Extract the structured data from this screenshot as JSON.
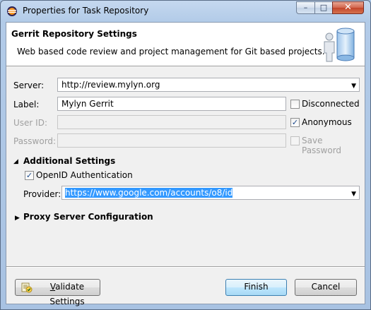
{
  "window": {
    "title": "Properties for Task Repository",
    "min_glyph": "–",
    "max_glyph": "□",
    "close_glyph": "✕"
  },
  "banner": {
    "title": "Gerrit Repository Settings",
    "description": "Web based code review and project management for Git based projects."
  },
  "form": {
    "server_label": "Server:",
    "server_value": "http://review.mylyn.org",
    "label_label": "Label:",
    "label_value": "Mylyn Gerrit",
    "userid_label": "User ID:",
    "userid_value": "",
    "password_label": "Password:",
    "password_value": "",
    "disconnected_label": "Disconnected",
    "disconnected_checked": false,
    "anonymous_label": "Anonymous",
    "anonymous_checked": true,
    "save_password_label": "Save Password",
    "save_password_checked": false
  },
  "additional": {
    "title": "Additional Settings",
    "expanded": true,
    "openid_label": "OpenID Authentication",
    "openid_checked": true,
    "provider_label": "Provider:",
    "provider_value": "https://www.google.com/accounts/o8/id"
  },
  "proxy": {
    "title": "Proxy Server Configuration",
    "expanded": false
  },
  "buttons": {
    "validate_prefix": "V",
    "validate_rest": "alidate Settings",
    "finish": "Finish",
    "cancel": "Cancel"
  },
  "glyphs": {
    "check": "✓",
    "expanded": "◢",
    "collapsed": "▶",
    "dropdown": "▼"
  },
  "colors": {
    "selection": "#3399ff",
    "title_gradient_top": "#c5d8ef",
    "dialog_bg": "#f0f0f0"
  }
}
